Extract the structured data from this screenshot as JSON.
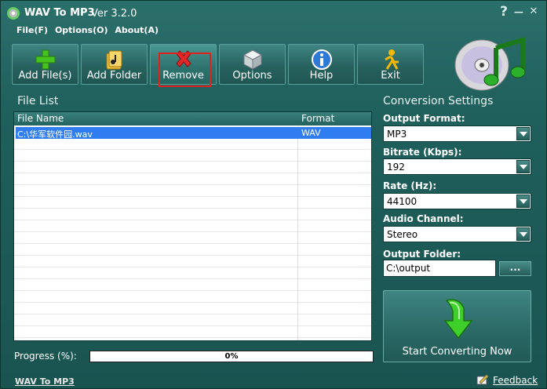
{
  "window": {
    "title": "WAV To MP3",
    "version": "Ver 3.2.0",
    "help_glyph": "?",
    "minimize_glyph": "—",
    "close_glyph": "✕"
  },
  "menu": [
    {
      "label": "File(F)"
    },
    {
      "label": "Options(O)"
    },
    {
      "label": "About(A)"
    }
  ],
  "toolbar": [
    {
      "label": "Add File(s)",
      "icon": "plus-icon"
    },
    {
      "label": "Add Folder",
      "icon": "folder-icon"
    },
    {
      "label": "Remove",
      "icon": "remove-x-icon"
    },
    {
      "label": "Options",
      "icon": "cube-icon"
    },
    {
      "label": "Help",
      "icon": "info-icon"
    },
    {
      "label": "Exit",
      "icon": "running-man-icon"
    }
  ],
  "file_list": {
    "title": "File List",
    "columns": [
      "File Name",
      "Format"
    ],
    "rows": [
      {
        "file_name": "C:\\华军软件园.wav",
        "format": "WAV",
        "selected": true
      }
    ]
  },
  "progress": {
    "label": "Progress (%):",
    "value": 0,
    "text": "0%"
  },
  "settings": {
    "title": "Conversion Settings",
    "output_format": {
      "label": "Output Format:",
      "value": "MP3"
    },
    "bitrate": {
      "label": "Bitrate (Kbps):",
      "value": "192"
    },
    "rate": {
      "label": "Rate (Hz):",
      "value": "44100"
    },
    "channel": {
      "label": "Audio Channel:",
      "value": "Stereo"
    },
    "output_folder": {
      "label": "Output Folder:",
      "value": "C:\\output",
      "browse": "..."
    }
  },
  "start_button": {
    "label": "Start Converting Now"
  },
  "footer": {
    "link": "WAV To MP3",
    "feedback": "Feedback"
  },
  "colors": {
    "background": "#1f5f5c",
    "selection": "#2f7df0",
    "highlight_border": "#e12020",
    "plus_green": "#45c21e",
    "remove_red": "#e0282a",
    "info_blue": "#2e78d6"
  }
}
